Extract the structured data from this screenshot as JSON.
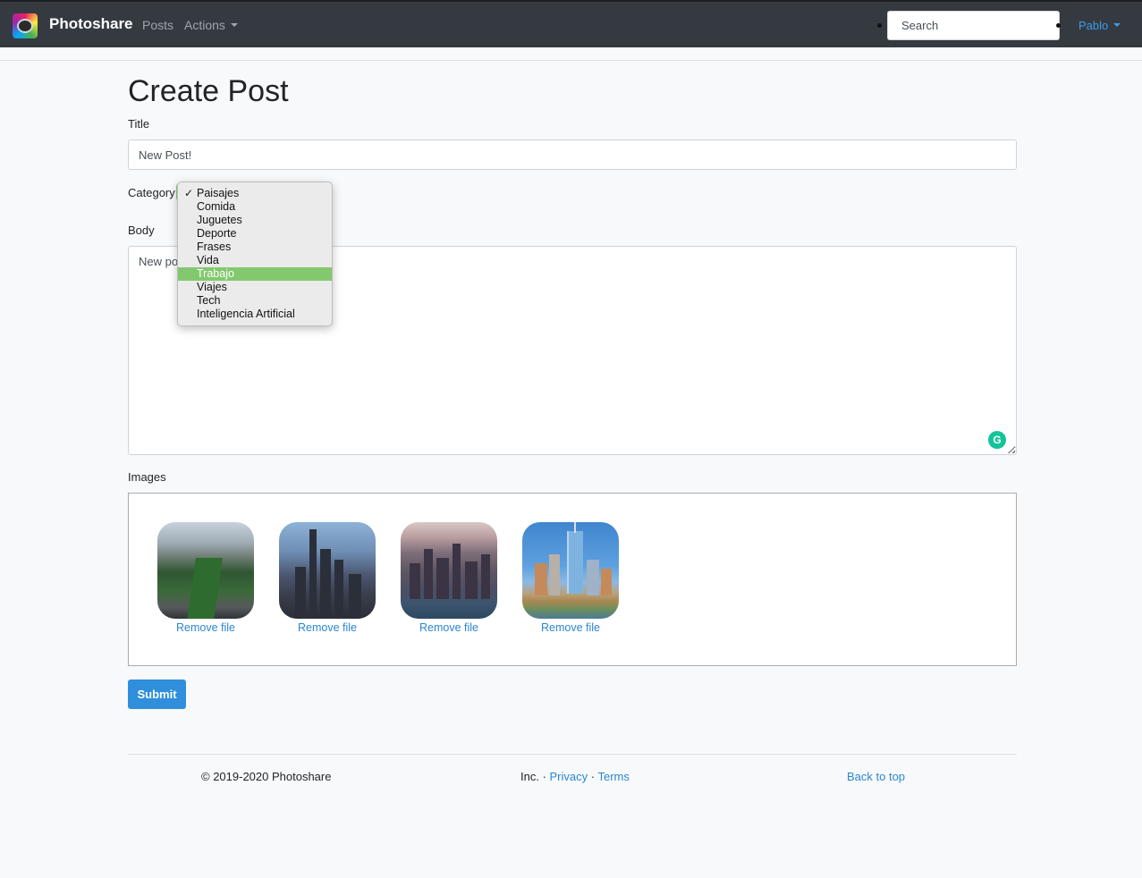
{
  "nav": {
    "brand": "Photoshare",
    "posts": "Posts",
    "actions": "Actions",
    "search_placeholder": "Search",
    "user": "Pablo"
  },
  "form": {
    "heading": "Create Post",
    "title_label": "Title",
    "title_value": "New Post!",
    "category_label": "Category",
    "category_selected": "Paisajes",
    "category_highlighted": "Trabajo",
    "category_options": [
      "Paisajes",
      "Comida",
      "Juguetes",
      "Deporte",
      "Frases",
      "Vida",
      "Trabajo",
      "Viajes",
      "Tech",
      "Inteligencia Artificial"
    ],
    "body_label": "Body",
    "body_visible_text": "New po",
    "images_label": "Images",
    "remove_file_label": "Remove file",
    "submit_label": "Submit"
  },
  "footer": {
    "copyright": "© 2019-2020 Photoshare",
    "inc": "Inc. · ",
    "privacy": "Privacy",
    "sep": " · ",
    "terms": "Terms",
    "back_to_top": "Back to top"
  },
  "colors": {
    "navbar": "#343a40",
    "accent": "#2f8fdc",
    "dropdown_highlight": "#83c86e",
    "grammarly": "#15c39a"
  },
  "icons": [
    "photoshare-logo-icon",
    "chevron-down-icon",
    "checkmark-icon",
    "grammarly-icon",
    "resize-handle-icon"
  ]
}
